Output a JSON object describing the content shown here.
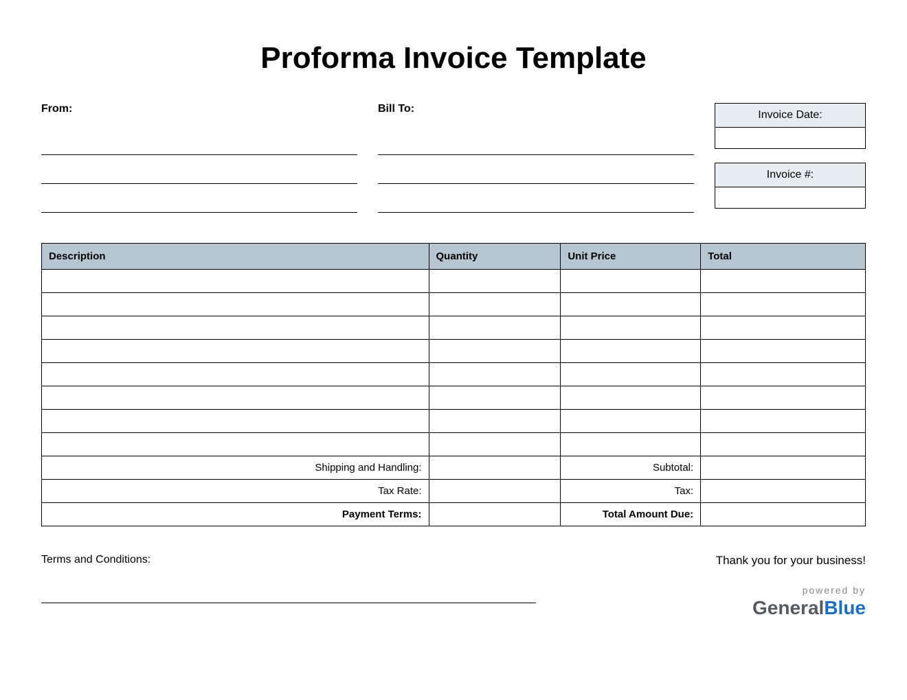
{
  "title": "Proforma Invoice Template",
  "from_label": "From:",
  "billto_label": "Bill To:",
  "invoice_date_label": "Invoice Date:",
  "invoice_date_value": "",
  "invoice_number_label": "Invoice #:",
  "invoice_number_value": "",
  "columns": {
    "description": "Description",
    "quantity": "Quantity",
    "unit_price": "Unit Price",
    "total": "Total"
  },
  "summary": {
    "shipping_label": "Shipping and Handling:",
    "subtotal_label": "Subtotal:",
    "tax_rate_label": "Tax Rate:",
    "tax_label": "Tax:",
    "payment_terms_label": "Payment Terms:",
    "total_due_label": "Total Amount Due:"
  },
  "terms_label": "Terms and Conditions:",
  "thankyou": "Thank you for your business!",
  "powered_by": "powered by",
  "brand_part1": "General",
  "brand_part2": "Blue"
}
